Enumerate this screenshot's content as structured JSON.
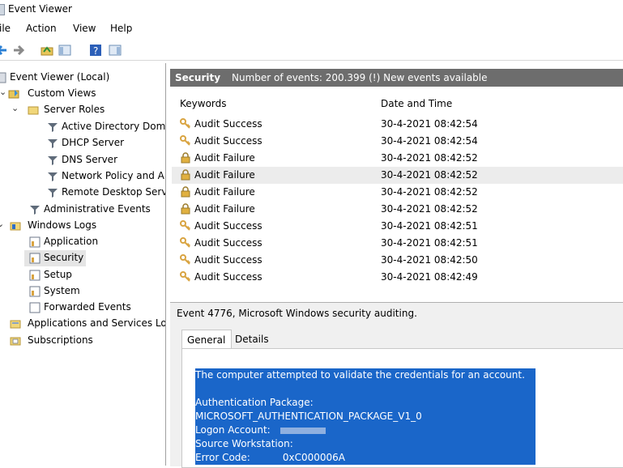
{
  "window": {
    "title": "Event Viewer"
  },
  "menu": [
    "File",
    "Action",
    "View",
    "Help"
  ],
  "menu_visible": [
    "ile",
    "Action",
    "View",
    "Help"
  ],
  "tree": {
    "root": "Event Viewer (Local)",
    "custom_views": "Custom Views",
    "server_roles": "Server Roles",
    "roles": [
      "Active Directory Dom",
      "DHCP Server",
      "DNS Server",
      "Network Policy and A",
      "Remote Desktop Serv"
    ],
    "admin_events": "Administrative Events",
    "windows_logs": "Windows Logs",
    "logs": [
      "Application",
      "Security",
      "Setup",
      "System",
      "Forwarded Events"
    ],
    "apps_services": "Applications and Services Lo",
    "subscriptions": "Subscriptions"
  },
  "main": {
    "log_name": "Security",
    "status": "Number of events: 200.399 (!) New events available",
    "columns": {
      "keywords": "Keywords",
      "datetime": "Date and Time"
    },
    "rows": [
      {
        "kw": "Audit Success",
        "dt": "30-4-2021 08:42:54",
        "type": "success"
      },
      {
        "kw": "Audit Success",
        "dt": "30-4-2021 08:42:54",
        "type": "success"
      },
      {
        "kw": "Audit Failure",
        "dt": "30-4-2021 08:42:52",
        "type": "failure"
      },
      {
        "kw": "Audit Failure",
        "dt": "30-4-2021 08:42:52",
        "type": "failure"
      },
      {
        "kw": "Audit Failure",
        "dt": "30-4-2021 08:42:52",
        "type": "failure"
      },
      {
        "kw": "Audit Failure",
        "dt": "30-4-2021 08:42:52",
        "type": "failure"
      },
      {
        "kw": "Audit Success",
        "dt": "30-4-2021 08:42:51",
        "type": "success"
      },
      {
        "kw": "Audit Success",
        "dt": "30-4-2021 08:42:51",
        "type": "success"
      },
      {
        "kw": "Audit Success",
        "dt": "30-4-2021 08:42:50",
        "type": "success"
      },
      {
        "kw": "Audit Success",
        "dt": "30-4-2021 08:42:49",
        "type": "success"
      }
    ],
    "selected_row": 3
  },
  "detail": {
    "title": "Event 4776, Microsoft Windows security auditing.",
    "tabs": [
      "General",
      "Details"
    ],
    "active_tab": "General",
    "description": "The computer attempted to validate the credentials for an account.",
    "fields": [
      {
        "label": "Authentication Package:",
        "value": "MICROSOFT_AUTHENTICATION_PACKAGE_V1_0"
      },
      {
        "label": "Logon Account:",
        "value": ""
      },
      {
        "label": "Source Workstation:",
        "value": ""
      },
      {
        "label": "Error Code:",
        "value": "0xC000006A"
      }
    ]
  },
  "colors": {
    "header_bg": "#6d6d6d",
    "selection": "#1a66c9",
    "tree_selected": "#e5e5e5"
  }
}
